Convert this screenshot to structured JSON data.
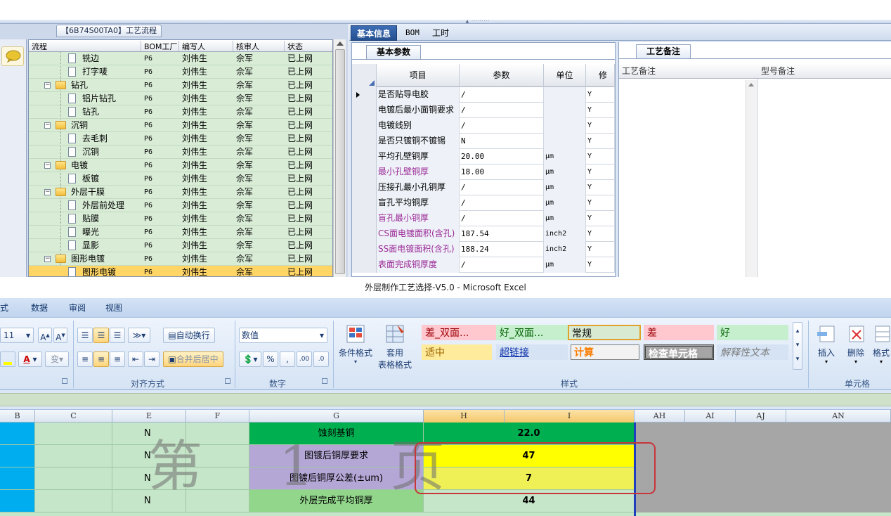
{
  "left_panel": {
    "title": "【6B74S00TA0】工艺流程",
    "columns": [
      "流程",
      "BOM工厂",
      "编写人",
      "核审人",
      "状态"
    ],
    "rows": [
      {
        "label": "铣边",
        "level": 2,
        "type": "doc",
        "bom": "P6",
        "writer": "刘伟生",
        "reviewer": "佘军",
        "status": "已上网"
      },
      {
        "label": "打字唛",
        "level": 2,
        "type": "doc",
        "bom": "P6",
        "writer": "刘伟生",
        "reviewer": "佘军",
        "status": "已上网"
      },
      {
        "label": "钻孔",
        "level": 1,
        "type": "folder",
        "bom": "P6",
        "writer": "刘伟生",
        "reviewer": "佘军",
        "status": "已上网"
      },
      {
        "label": "铝片钻孔",
        "level": 2,
        "type": "doc",
        "bom": "P6",
        "writer": "刘伟生",
        "reviewer": "佘军",
        "status": "已上网"
      },
      {
        "label": "钻孔",
        "level": 2,
        "type": "doc",
        "bom": "P6",
        "writer": "刘伟生",
        "reviewer": "佘军",
        "status": "已上网"
      },
      {
        "label": "沉铜",
        "level": 1,
        "type": "folder",
        "bom": "P6",
        "writer": "刘伟生",
        "reviewer": "佘军",
        "status": "已上网"
      },
      {
        "label": "去毛刺",
        "level": 2,
        "type": "doc",
        "bom": "P6",
        "writer": "刘伟生",
        "reviewer": "佘军",
        "status": "已上网"
      },
      {
        "label": "沉铜",
        "level": 2,
        "type": "doc",
        "bom": "P6",
        "writer": "刘伟生",
        "reviewer": "佘军",
        "status": "已上网"
      },
      {
        "label": "电镀",
        "level": 1,
        "type": "folder",
        "bom": "P6",
        "writer": "刘伟生",
        "reviewer": "佘军",
        "status": "已上网"
      },
      {
        "label": "板镀",
        "level": 2,
        "type": "doc",
        "bom": "P6",
        "writer": "刘伟生",
        "reviewer": "佘军",
        "status": "已上网"
      },
      {
        "label": "外层干膜",
        "level": 1,
        "type": "folder",
        "bom": "P6",
        "writer": "刘伟生",
        "reviewer": "佘军",
        "status": "已上网"
      },
      {
        "label": "外层前处理",
        "level": 2,
        "type": "doc",
        "bom": "P6",
        "writer": "刘伟生",
        "reviewer": "佘军",
        "status": "已上网"
      },
      {
        "label": "贴膜",
        "level": 2,
        "type": "doc",
        "bom": "P6",
        "writer": "刘伟生",
        "reviewer": "佘军",
        "status": "已上网"
      },
      {
        "label": "曝光",
        "level": 2,
        "type": "doc",
        "bom": "P6",
        "writer": "刘伟生",
        "reviewer": "佘军",
        "status": "已上网"
      },
      {
        "label": "显影",
        "level": 2,
        "type": "doc",
        "bom": "P6",
        "writer": "刘伟生",
        "reviewer": "佘军",
        "status": "已上网"
      },
      {
        "label": "图形电镀",
        "level": 1,
        "type": "folder",
        "bom": "P6",
        "writer": "刘伟生",
        "reviewer": "佘军",
        "status": "已上网"
      },
      {
        "label": "图形电镀",
        "level": 2,
        "type": "doc",
        "bom": "P6",
        "writer": "刘伟生",
        "reviewer": "佘军",
        "status": "已上网",
        "selected": true
      }
    ]
  },
  "right_panel": {
    "tabs": [
      "基本信息",
      "BOM",
      "工时"
    ],
    "params_tab": "基本参数",
    "notes_tab": "工艺备注",
    "param_columns": [
      "项目",
      "参数",
      "单位",
      "修改"
    ],
    "params": [
      {
        "item": "是否贴导电胶",
        "value": "/",
        "unit": "",
        "mod": "Y",
        "purple": false
      },
      {
        "item": "电镀后最小面铜要求",
        "value": "/",
        "unit": "",
        "mod": "Y",
        "purple": false
      },
      {
        "item": "电镀线别",
        "value": "/",
        "unit": "",
        "mod": "Y",
        "purple": false
      },
      {
        "item": "是否只镀铜不镀锡",
        "value": "N",
        "unit": "",
        "mod": "Y",
        "purple": false
      },
      {
        "item": "平均孔壁铜厚",
        "value": "20.00",
        "unit": "μm",
        "mod": "Y",
        "purple": false
      },
      {
        "item": "最小孔壁铜厚",
        "value": "18.00",
        "unit": "μm",
        "mod": "Y",
        "purple": true
      },
      {
        "item": "压接孔最小孔铜厚",
        "value": "/",
        "unit": "μm",
        "mod": "Y",
        "purple": false
      },
      {
        "item": "盲孔平均铜厚",
        "value": "/",
        "unit": "μm",
        "mod": "Y",
        "purple": false
      },
      {
        "item": "盲孔最小铜厚",
        "value": "/",
        "unit": "μm",
        "mod": "Y",
        "purple": true
      },
      {
        "item": "CS面电镀面积(含孔)",
        "value": "187.54",
        "unit": "inch2",
        "mod": "Y",
        "purple": true
      },
      {
        "item": "SS面电镀面积(含孔)",
        "value": "188.24",
        "unit": "inch2",
        "mod": "Y",
        "purple": true
      },
      {
        "item": "表面完成铜厚度",
        "value": "/",
        "unit": "μm",
        "mod": "Y",
        "purple": true
      }
    ],
    "notes_columns": [
      "工艺备注",
      "型号备注"
    ]
  },
  "excel": {
    "title": "外层制作工艺选择-V5.0 - Microsoft Excel",
    "ribbon_tabs": [
      "式",
      "数据",
      "审阅",
      "视图"
    ],
    "font_size": "11",
    "wrap_text": "自动换行",
    "merge_center": "合并后居中",
    "number_format": "数值",
    "group_labels": {
      "align": "对齐方式",
      "number": "数字",
      "styles": "样式",
      "cells": "单元格"
    },
    "cond_format": "条件格式",
    "table_format_1": "套用",
    "table_format_2": "表格格式",
    "insert": "插入",
    "delete": "删除",
    "format": "格式",
    "styles": [
      {
        "label": "差_双面...",
        "bg": "#ffc7ce",
        "fg": "#9c0006"
      },
      {
        "label": "好_双面...",
        "bg": "#c6efce",
        "fg": "#006100"
      },
      {
        "label": "常规",
        "bg": "#d9ead3",
        "fg": "#000000"
      },
      {
        "label": "差",
        "bg": "#ffc7ce",
        "fg": "#9c0006"
      },
      {
        "label": "好",
        "bg": "#c6efce",
        "fg": "#006100"
      },
      {
        "label": "适中",
        "bg": "#ffeb9c",
        "fg": "#9c6500"
      },
      {
        "label": "超链接",
        "bg": "#d5e3f4",
        "fg": "#0b2fa8"
      },
      {
        "label": "计算",
        "bg": "#f2f2f2",
        "fg": "#fa7d00"
      },
      {
        "label": "检查单元格",
        "bg": "#a5a5a5",
        "fg": "#ffffff"
      },
      {
        "label": "解释性文本",
        "bg": "#d5e3f4",
        "fg": "#7f7f7f"
      }
    ],
    "columns": [
      "B",
      "C",
      "E",
      "F",
      "G",
      "H",
      "I",
      "AH",
      "AI",
      "AJ",
      "AN"
    ],
    "watermark": "第 1 页",
    "rows": [
      {
        "e": "N",
        "g": "蚀刻基铜",
        "h": "22.0"
      },
      {
        "e": "N",
        "g": "图镀后铜厚要求",
        "h": "47"
      },
      {
        "e": "N",
        "g": "图镀后铜厚公差(±um)",
        "h": "7"
      },
      {
        "e": "N",
        "g": "外层完成平均铜厚",
        "h": "44"
      }
    ]
  },
  "colors": {
    "accent": "#24508f",
    "highlight": "#c8363a",
    "sheet_green": "#c6e6c9"
  }
}
